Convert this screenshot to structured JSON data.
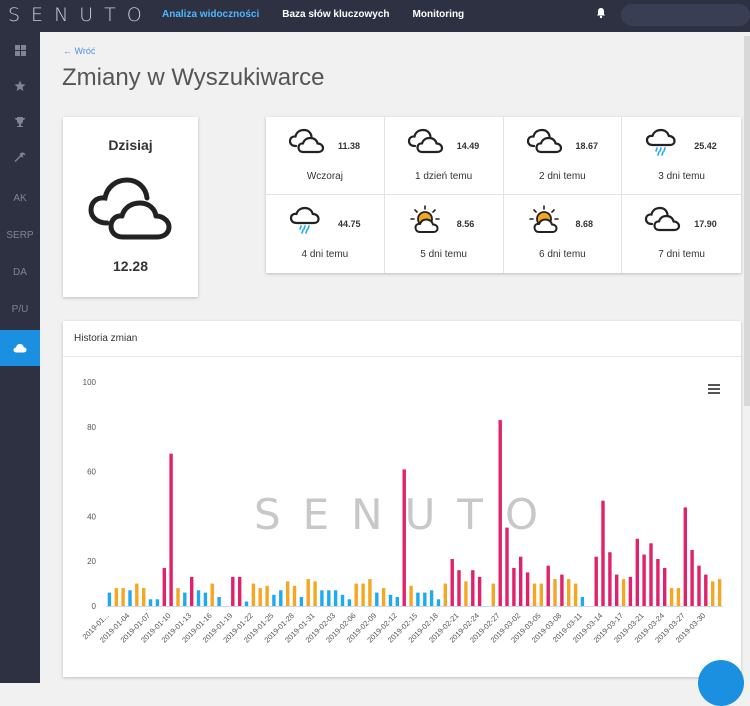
{
  "app": {
    "logo": "SENUTO"
  },
  "nav": {
    "items": [
      "Analiza widoczności",
      "Baza słów kluczowych",
      "Monitoring"
    ],
    "active": 0
  },
  "sidebar": {
    "items": [
      {
        "icon": "dashboard-icon",
        "label": ""
      },
      {
        "icon": "star-icon",
        "label": ""
      },
      {
        "icon": "trophy-icon",
        "label": ""
      },
      {
        "icon": "wrench-icon",
        "label": ""
      },
      {
        "icon": "",
        "label": "AK"
      },
      {
        "icon": "",
        "label": "SERP"
      },
      {
        "icon": "",
        "label": "DA"
      },
      {
        "icon": "",
        "label": "P/U"
      },
      {
        "icon": "cloud-icon",
        "label": "",
        "active": true
      }
    ]
  },
  "page": {
    "back": "← Wróć",
    "title": "Zmiany w Wyszukiwarce"
  },
  "today": {
    "label": "Dzisiaj",
    "value": "12.28",
    "icon": "cloud-icon"
  },
  "days": [
    {
      "value": "11.38",
      "label": "Wczoraj",
      "icon": "cloud-icon"
    },
    {
      "value": "14.49",
      "label": "1 dzień temu",
      "icon": "cloud-icon"
    },
    {
      "value": "18.67",
      "label": "2 dni temu",
      "icon": "cloud-icon"
    },
    {
      "value": "25.42",
      "label": "3 dni temu",
      "icon": "rain-cloud-icon"
    },
    {
      "value": "44.75",
      "label": "4 dni temu",
      "icon": "rain-cloud-icon"
    },
    {
      "value": "8.56",
      "label": "5 dni temu",
      "icon": "sun-cloud-icon"
    },
    {
      "value": "8.68",
      "label": "6 dni temu",
      "icon": "sun-cloud-icon"
    },
    {
      "value": "17.90",
      "label": "7 dni temu",
      "icon": "cloud-icon"
    }
  ],
  "history": {
    "title": "Historia zmian",
    "watermark": "SENUTO"
  },
  "colors": {
    "low": "#1fa9f0",
    "mid": "#f5a623",
    "high": "#e0216b",
    "accent": "#1b8fe0",
    "dark": "#2d3142"
  },
  "chart_data": {
    "type": "bar",
    "ylim": [
      0,
      100
    ],
    "yticks": [
      0,
      20,
      40,
      60,
      80,
      100
    ],
    "xtick_labels": [
      "2019-01...",
      "2019-01-04",
      "2019-01-07",
      "2019-01-10",
      "2019-01-13",
      "2019-01-16",
      "2019-01-19",
      "2019-01-22",
      "2019-01-25",
      "2019-01-28",
      "2019-01-31",
      "2019-02-03",
      "2019-02-06",
      "2019-02-09",
      "2019-02-12",
      "2019-02-15",
      "2019-02-18",
      "2019-02-21",
      "2019-02-24",
      "2019-02-27",
      "2019-03-02",
      "2019-03-05",
      "2019-03-08",
      "2019-03-11",
      "2019-03-14",
      "2019-03-17",
      "2019-03-21",
      "2019-03-24",
      "2019-03-27",
      "2019-03-30"
    ],
    "values": [
      6,
      8,
      8,
      7,
      10,
      8,
      3,
      3,
      17,
      68,
      8,
      6,
      13,
      7,
      6,
      10,
      4,
      0,
      13,
      13,
      2,
      10,
      8,
      9,
      5,
      7,
      11,
      9,
      4,
      12,
      11,
      7,
      7,
      7,
      5,
      3,
      10,
      10,
      12,
      6,
      8,
      5,
      4,
      61,
      9,
      6,
      6,
      7,
      3,
      10,
      21,
      16,
      11,
      16,
      13,
      0,
      10,
      83,
      35,
      17,
      22,
      15,
      10,
      10,
      18,
      12,
      14,
      12,
      10,
      4,
      0,
      22,
      47,
      24,
      14,
      12,
      13,
      30,
      23,
      28,
      21,
      17,
      8,
      8,
      44,
      25,
      18,
      14,
      11,
      12
    ],
    "color_rule": "value < 8 blue, 8–12 orange, >= 13 magenta"
  }
}
